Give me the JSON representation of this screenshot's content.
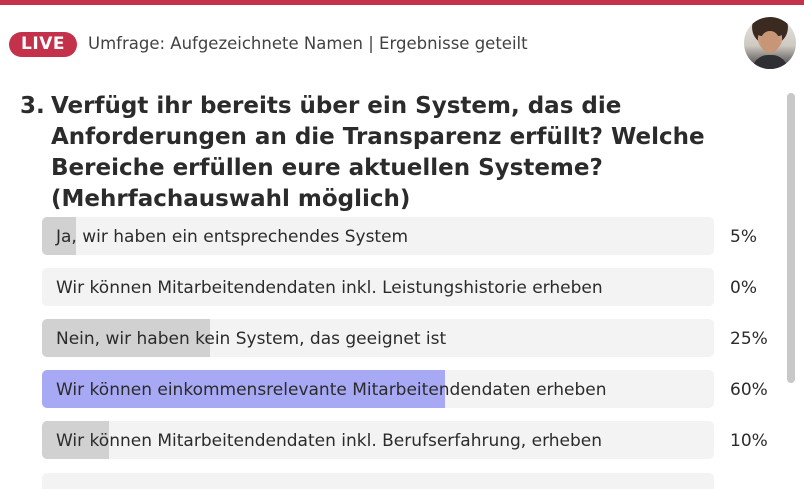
{
  "header": {
    "live_label": "LIVE",
    "title": "Umfrage: Aufgezeichnete Namen | Ergebnisse geteilt"
  },
  "question": {
    "number": "3.",
    "text": "Verfügt ihr bereits über ein System, das die Anforderungen an die Transparenz erfüllt? Welche Bereiche erfüllen eure aktuellen Systeme? (Mehrfachauswahl möglich)"
  },
  "options": [
    {
      "label": "Ja, wir haben ein entsprechendes System",
      "percent_text": "5%",
      "value": 5,
      "selected": false
    },
    {
      "label": "Wir können Mitarbeitendendaten inkl. Leistungshistorie erheben",
      "percent_text": "0%",
      "value": 0,
      "selected": false
    },
    {
      "label": "Nein, wir haben kein System, das geeignet ist",
      "percent_text": "25%",
      "value": 25,
      "selected": false
    },
    {
      "label": "Wir können einkommensrelevante Mitarbeitendendaten erheben",
      "percent_text": "60%",
      "value": 60,
      "selected": true
    },
    {
      "label": "Wir können Mitarbeitendendaten inkl. Berufserfahrung, erheben",
      "percent_text": "10%",
      "value": 10,
      "selected": false
    }
  ],
  "colors": {
    "accent": "#c4314b",
    "selected_fill": "#a8a9f5",
    "bar_fill": "#d1d1d1",
    "bar_track": "#f3f3f3"
  },
  "icons": {
    "avatar": "user-avatar"
  }
}
